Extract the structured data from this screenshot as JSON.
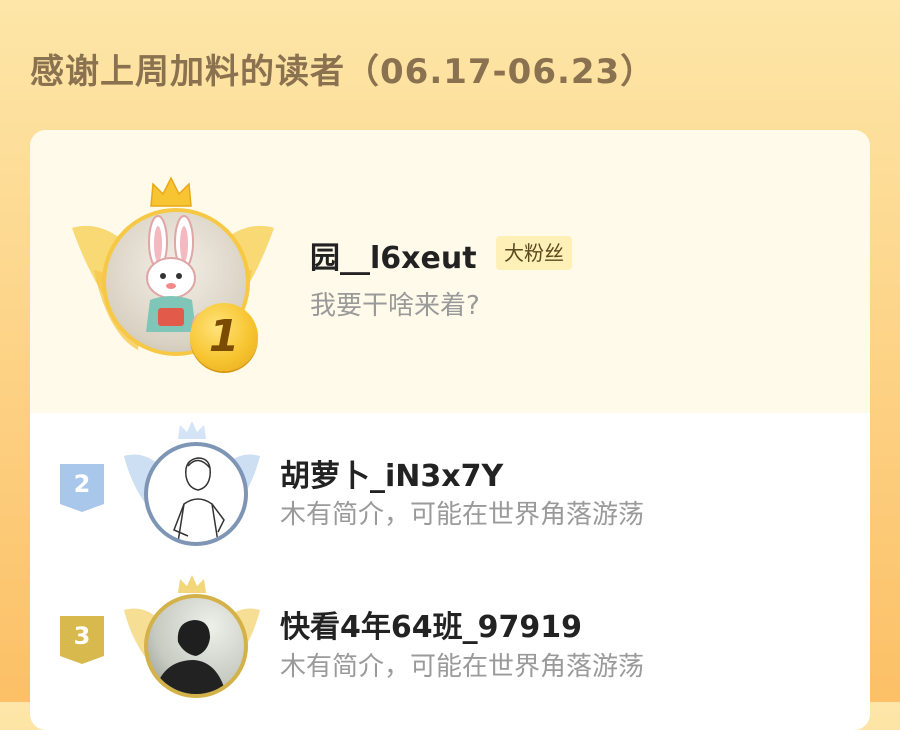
{
  "header": {
    "title": "感谢上周加料的读者（06.17-06.23）"
  },
  "colors": {
    "gold": "#f7c531",
    "silver_blue": "#9fc0e6",
    "bronze": "#d8b94e",
    "avatar2_ring": "#7f95b5",
    "avatar3_ring": "#d4b24a"
  },
  "readers": [
    {
      "rank": "1",
      "name": "园__l6xeut",
      "badge": "大粉丝",
      "bio": "我要干啥来着?"
    },
    {
      "rank": "2",
      "name": "胡萝卜_iN3x7Y",
      "bio": "木有简介，可能在世界角落游荡"
    },
    {
      "rank": "3",
      "name": "快看4年64班_97919",
      "bio": "木有简介，可能在世界角落游荡"
    }
  ]
}
